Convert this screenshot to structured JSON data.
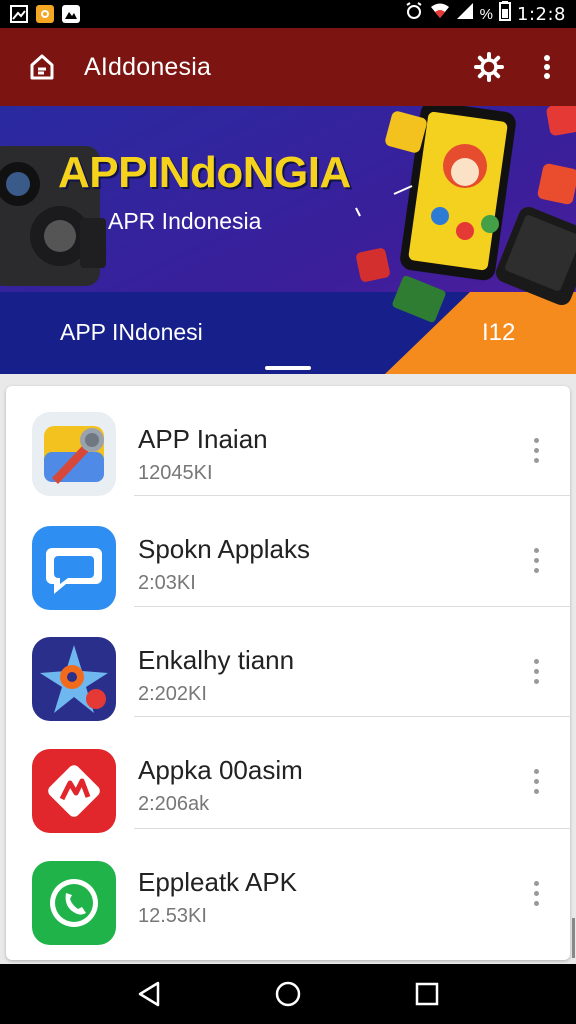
{
  "status_bar": {
    "time": "1:2:8",
    "battery_label": "%"
  },
  "app_bar": {
    "title": "AIddonesia"
  },
  "banner": {
    "headline": "APPINdoNGIA",
    "subtitle": "APR Indonesia",
    "caption": "APP INdonesi",
    "count": "I12"
  },
  "apps": [
    {
      "name": "APP Inaian",
      "meta": "12045KI",
      "icon": "microphone-app-icon"
    },
    {
      "name": "Spokn Applaks",
      "meta": "2:03KI",
      "icon": "chat-bubble-app-icon"
    },
    {
      "name": "Enkalhy tiann",
      "meta": "2:202KI",
      "icon": "star-eye-app-icon"
    },
    {
      "name": "Appka 00asim",
      "meta": "2:206ak",
      "icon": "red-diamond-app-icon"
    },
    {
      "name": "Eppleatk APK",
      "meta": "12.53KI",
      "icon": "whatsapp-phone-app-icon"
    }
  ],
  "colors": {
    "app_bar": "#7c1411",
    "banner_bg": "#1a1f86",
    "banner_accent": "#f5d31c"
  }
}
